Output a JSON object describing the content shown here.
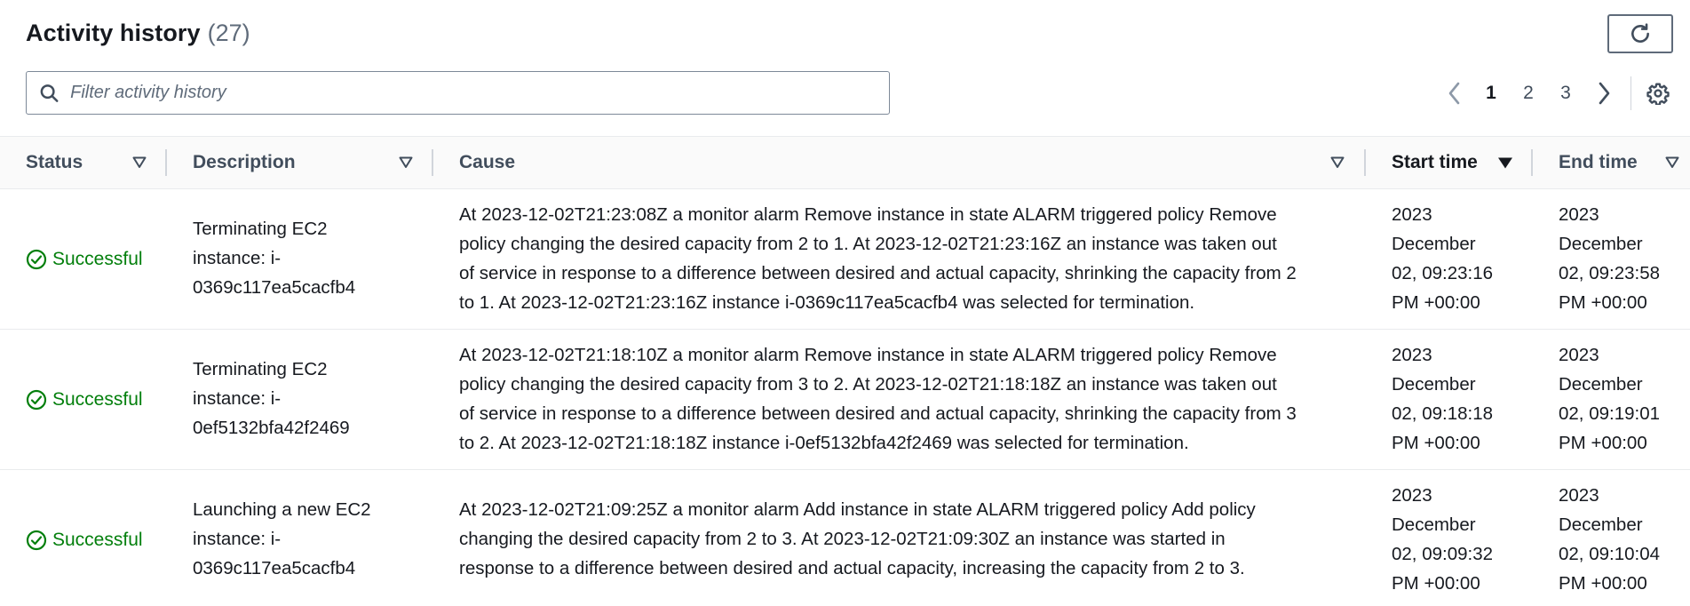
{
  "header": {
    "title": "Activity history",
    "count": "(27)"
  },
  "refresh_icon": "refresh-icon",
  "filter": {
    "placeholder": "Filter activity history",
    "value": "",
    "icon": "search-icon"
  },
  "pagination": {
    "pages": [
      "1",
      "2",
      "3"
    ],
    "current": "1"
  },
  "settings_icon": "gear-icon",
  "columns": {
    "status": "Status",
    "description": "Description",
    "cause": "Cause",
    "start_time": "Start time",
    "end_time": "End time"
  },
  "rows": [
    {
      "status": "Successful",
      "description": [
        "Terminating EC2",
        "instance: i-",
        "0369c117ea5cacfb4"
      ],
      "cause": [
        "At 2023-12-02T21:23:08Z a monitor alarm Remove instance in state ALARM triggered policy Remove",
        "policy changing the desired capacity from 2 to 1. At 2023-12-02T21:23:16Z an instance was taken out",
        "of service in response to a difference between desired and actual capacity, shrinking the capacity from 2",
        "to 1. At 2023-12-02T21:23:16Z instance i-0369c117ea5cacfb4 was selected for termination."
      ],
      "start": [
        "2023",
        "December",
        "02, 09:23:16",
        "PM +00:00"
      ],
      "end": [
        "2023",
        "December",
        "02, 09:23:58",
        "PM +00:00"
      ]
    },
    {
      "status": "Successful",
      "description": [
        "Terminating EC2",
        "instance: i-",
        "0ef5132bfa42f2469"
      ],
      "cause": [
        "At 2023-12-02T21:18:10Z a monitor alarm Remove instance in state ALARM triggered policy Remove",
        "policy changing the desired capacity from 3 to 2. At 2023-12-02T21:18:18Z an instance was taken out",
        "of service in response to a difference between desired and actual capacity, shrinking the capacity from 3",
        "to 2. At 2023-12-02T21:18:18Z instance i-0ef5132bfa42f2469 was selected for termination."
      ],
      "start": [
        "2023",
        "December",
        "02, 09:18:18",
        "PM +00:00"
      ],
      "end": [
        "2023",
        "December",
        "02, 09:19:01",
        "PM +00:00"
      ]
    },
    {
      "status": "Successful",
      "description": [
        "Launching a new EC2",
        "instance: i-",
        "0369c117ea5cacfb4"
      ],
      "cause": [
        "At 2023-12-02T21:09:25Z a monitor alarm Add instance in state ALARM triggered policy Add policy",
        "changing the desired capacity from 2 to 3. At 2023-12-02T21:09:30Z an instance was started in",
        "response to a difference between desired and actual capacity, increasing the capacity from 2 to 3."
      ],
      "start": [
        "2023",
        "December",
        "02, 09:09:32",
        "PM +00:00"
      ],
      "end": [
        "2023",
        "December",
        "02, 09:10:04",
        "PM +00:00"
      ]
    }
  ],
  "colors": {
    "success": "#037f0c",
    "text": "#16191f",
    "muted": "#5f6b7a"
  }
}
